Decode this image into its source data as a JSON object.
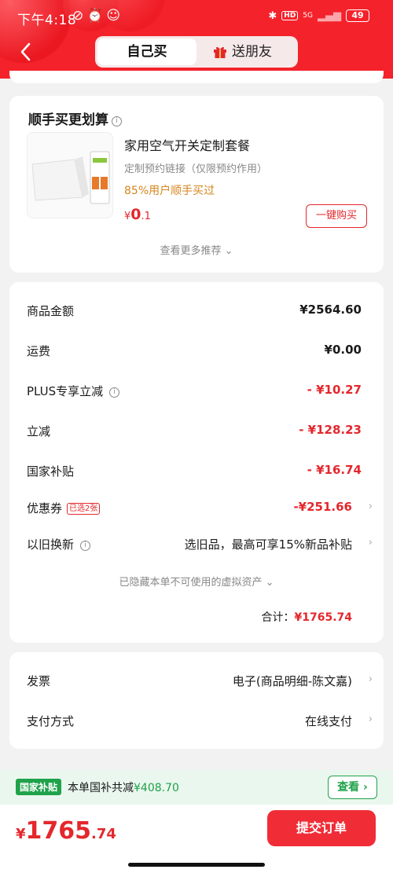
{
  "status_bar": {
    "time": "下午4:18",
    "network": "5G",
    "battery": "49"
  },
  "header": {
    "tab_self": "自己买",
    "tab_gift": "送朋友"
  },
  "bundle": {
    "title": "顺手买更划算",
    "product_name": "家用空气开关定制套餐",
    "product_desc": "定制预约链接（仅限预约作用）",
    "product_rate": "85%用户顺手买过",
    "price_currency": "¥",
    "price_int": "0",
    "price_dec": ".1",
    "buy_label": "一键购买",
    "more_label": "查看更多推荐 ⌄"
  },
  "summary": {
    "rows": [
      {
        "label": "商品金额",
        "value": "¥2564.60"
      },
      {
        "label": "运费",
        "value": "¥0.00"
      },
      {
        "label": "PLUS专享立减",
        "value": "- ¥10.27"
      },
      {
        "label": "立减",
        "value": "- ¥128.23"
      },
      {
        "label": "国家补贴",
        "value": "- ¥16.74"
      },
      {
        "label": "优惠券",
        "badge": "已选2张",
        "value": "-¥251.66"
      },
      {
        "label": "以旧换新",
        "value": "选旧品，最高可享15%新品补贴"
      }
    ],
    "hidden_note": "已隐藏本单不可使用的虚拟资产 ⌄",
    "total_label": "合计：",
    "total_value": "¥1765.74"
  },
  "invoice": {
    "label": "发票",
    "value": "电子(商品明细-陈文嘉)"
  },
  "payment": {
    "label": "支付方式",
    "value": "在线支付"
  },
  "subsidy": {
    "tag": "国家补贴",
    "text_prefix": "本单国补共减",
    "amount": "¥408.70",
    "check_label": "查看 ›"
  },
  "bottom": {
    "currency": "¥",
    "int": "1765",
    "dec": ".74",
    "submit_label": "提交订单"
  },
  "colors": {
    "brand_red": "#f4222b",
    "price_red": "#e4272c",
    "subsidy_green": "#1fa24a",
    "rate_orange": "#d6861e"
  }
}
